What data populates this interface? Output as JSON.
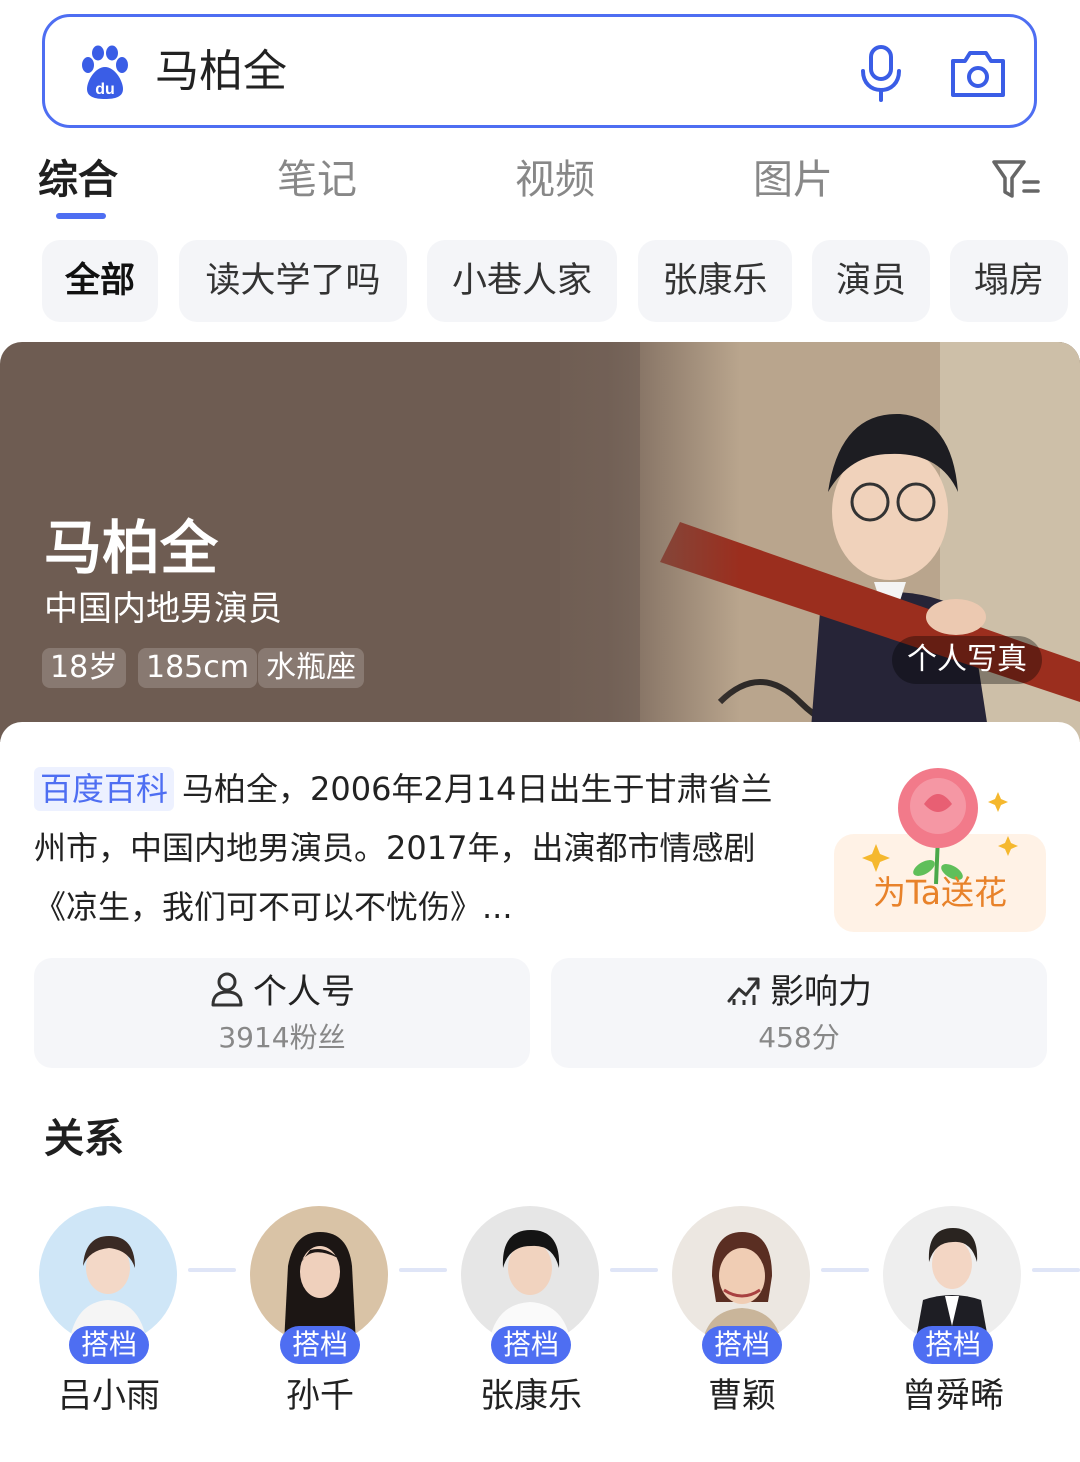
{
  "search": {
    "query": "马柏全"
  },
  "tabs": [
    {
      "label": "综合"
    },
    {
      "label": "笔记"
    },
    {
      "label": "视频"
    },
    {
      "label": "图片"
    }
  ],
  "chips": [
    {
      "label": "全部"
    },
    {
      "label": "读大学了吗"
    },
    {
      "label": "小巷人家"
    },
    {
      "label": "张康乐"
    },
    {
      "label": "演员"
    },
    {
      "label": "塌房"
    }
  ],
  "profile": {
    "name": "马柏全",
    "description": "中国内地男演员",
    "tags": [
      "18岁",
      "185cm",
      "水瓶座"
    ],
    "photo_label": "个人写真"
  },
  "intro": {
    "source_tag": "百度百科",
    "text": "马柏全，2006年2月14日出生于甘肃省兰州市，中国内地男演员。2017年，出演都市情感剧《凉生，我们可不可以不忧伤》..."
  },
  "flower": {
    "label": "为Ta送花"
  },
  "stats": [
    {
      "title": "个人号",
      "value": "3914粉丝",
      "icon": "person-icon"
    },
    {
      "title": "影响力",
      "value": "458分",
      "icon": "trend-icon"
    }
  ],
  "relations": {
    "title": "关系",
    "people": [
      {
        "name": "吕小雨",
        "badge": "搭档"
      },
      {
        "name": "孙千",
        "badge": "搭档"
      },
      {
        "name": "张康乐",
        "badge": "搭档"
      },
      {
        "name": "曹颖",
        "badge": "搭档"
      },
      {
        "name": "曾舜晞",
        "badge": "搭档"
      }
    ]
  },
  "colors": {
    "accent": "#4e6ef2",
    "hero_bg": "#6e5c52",
    "flower_text": "#e8822a"
  }
}
